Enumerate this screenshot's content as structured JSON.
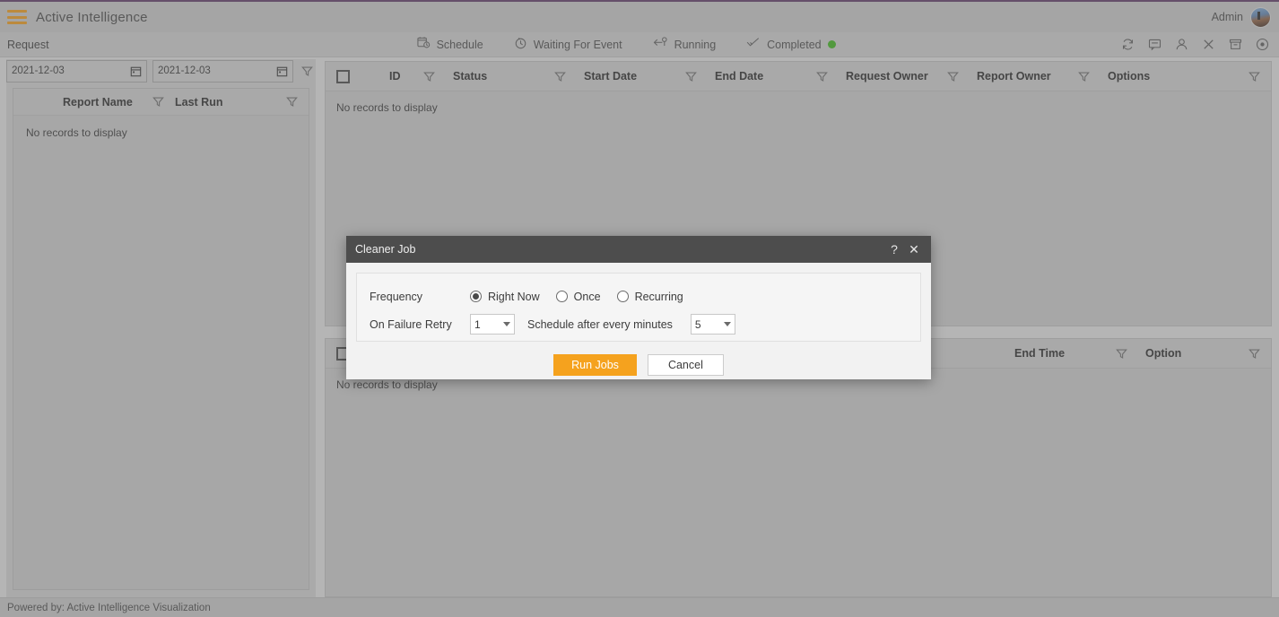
{
  "topbar": {
    "menu_icon": "hamburger-icon",
    "title": "Active Intelligence",
    "user_label": "Admin",
    "avatar_icon": "avatar"
  },
  "actionbar": {
    "section_label": "Request",
    "items": [
      {
        "icon": "calendar-clock-icon",
        "label": "Schedule"
      },
      {
        "icon": "stopwatch-icon",
        "label": "Waiting For Event"
      },
      {
        "icon": "running-arrow-icon",
        "label": "Running"
      },
      {
        "icon": "check-icon",
        "label": "Completed",
        "status_dot": "#3faa20"
      }
    ],
    "icons": [
      "refresh-icon",
      "comment-icon",
      "user-icon",
      "close-icon",
      "archive-icon",
      "cancel-circle-icon"
    ]
  },
  "left_panel": {
    "date_from": {
      "value": "2021-12-03",
      "placeholder": "yyyy-mm-dd"
    },
    "date_to": {
      "value": "2021-12-03",
      "placeholder": "yyyy-mm-dd"
    },
    "filter_icon": "funnel-icon",
    "columns": [
      {
        "label": "Report Name"
      },
      {
        "label": "Last Run"
      }
    ],
    "empty_text": "No records to display"
  },
  "main_grid_top": {
    "columns": [
      {
        "label": "ID"
      },
      {
        "label": "Status"
      },
      {
        "label": "Start Date"
      },
      {
        "label": "End Date"
      },
      {
        "label": "Request Owner"
      },
      {
        "label": "Report Owner"
      },
      {
        "label": "Options"
      }
    ],
    "empty_text": "No records to display"
  },
  "main_grid_bottom": {
    "columns": [
      {
        "label": "End Time"
      },
      {
        "label": "Option"
      }
    ],
    "empty_text": "No records to display"
  },
  "footer": {
    "text": "Powered by: Active Intelligence Visualization"
  },
  "dialog": {
    "title": "Cleaner Job",
    "help_label": "?",
    "close_label": "✕",
    "frequency_label": "Frequency",
    "frequency_options": [
      {
        "label": "Right Now",
        "selected": true
      },
      {
        "label": "Once",
        "selected": false
      },
      {
        "label": "Recurring",
        "selected": false
      }
    ],
    "retry_label": "On Failure Retry",
    "retry_value": "1",
    "schedule_label": "Schedule after every minutes",
    "schedule_value": "5",
    "primary_button": "Run Jobs",
    "secondary_button": "Cancel",
    "accent_color": "#f5a21e"
  }
}
